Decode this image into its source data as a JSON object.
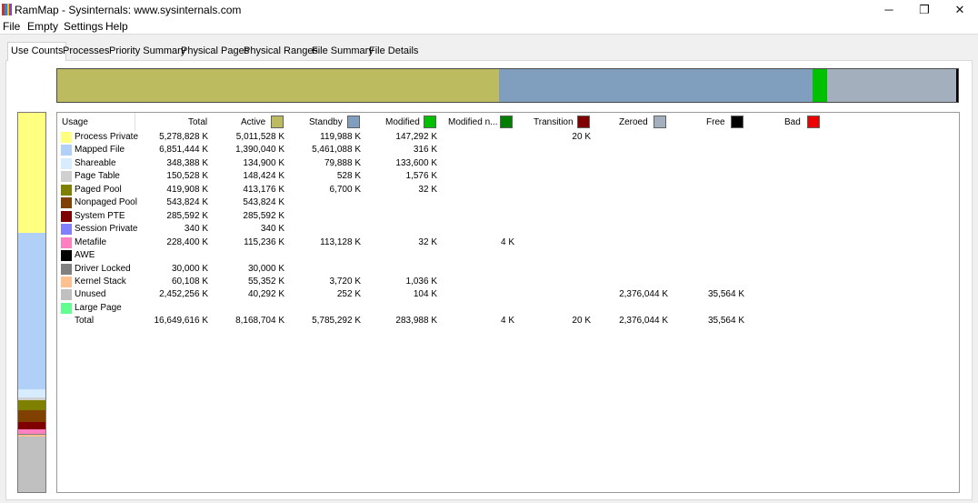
{
  "window": {
    "title": "RamMap - Sysinternals: www.sysinternals.com",
    "app_icon_colors": [
      "#c0392b",
      "#2e86de",
      "#f1c40f",
      "#8e44ad"
    ],
    "minimize_glyph": "─",
    "maximize_glyph": "❐",
    "close_glyph": "✕"
  },
  "menu": {
    "items": [
      "File",
      "Empty",
      "Settings",
      "Help"
    ]
  },
  "tabs": [
    "Use Counts",
    "Processes",
    "Priority Summary",
    "Physical Pages",
    "Physical Ranges",
    "File Summary",
    "File Details"
  ],
  "active_tab": "Use Counts",
  "columns": [
    {
      "label": "Usage",
      "color": null
    },
    {
      "label": "Total",
      "color": null
    },
    {
      "label": "Active",
      "color": "#bdbb5f"
    },
    {
      "label": "Standby",
      "color": "#809fbf"
    },
    {
      "label": "Modified",
      "color": "#00c000"
    },
    {
      "label": "Modified n...",
      "color": "#007f00"
    },
    {
      "label": "Transition",
      "color": "#800000"
    },
    {
      "label": "Zeroed",
      "color": "#a3afbd"
    },
    {
      "label": "Free",
      "color": "#000000"
    },
    {
      "label": "Bad",
      "color": "#ee0000"
    }
  ],
  "rows": [
    {
      "label": "Process Private",
      "color": "#ffff80",
      "total": "5,278,828 K",
      "active": "5,011,528 K",
      "standby": "119,988 K",
      "modified": "147,292 K",
      "modified_n": "",
      "transition": "20 K",
      "zeroed": "",
      "free": "",
      "bad": ""
    },
    {
      "label": "Mapped File",
      "color": "#b0d0f8",
      "total": "6,851,444 K",
      "active": "1,390,040 K",
      "standby": "5,461,088 K",
      "modified": "316 K",
      "modified_n": "",
      "transition": "",
      "zeroed": "",
      "free": "",
      "bad": ""
    },
    {
      "label": "Shareable",
      "color": "#d8ecff",
      "total": "348,388 K",
      "active": "134,900 K",
      "standby": "79,888 K",
      "modified": "133,600 K",
      "modified_n": "",
      "transition": "",
      "zeroed": "",
      "free": "",
      "bad": ""
    },
    {
      "label": "Page Table",
      "color": "#d0d0d0",
      "total": "150,528 K",
      "active": "148,424 K",
      "standby": "528 K",
      "modified": "1,576 K",
      "modified_n": "",
      "transition": "",
      "zeroed": "",
      "free": "",
      "bad": ""
    },
    {
      "label": "Paged Pool",
      "color": "#808000",
      "total": "419,908 K",
      "active": "413,176 K",
      "standby": "6,700 K",
      "modified": "32 K",
      "modified_n": "",
      "transition": "",
      "zeroed": "",
      "free": "",
      "bad": ""
    },
    {
      "label": "Nonpaged Pool",
      "color": "#804000",
      "total": "543,824 K",
      "active": "543,824 K",
      "standby": "",
      "modified": "",
      "modified_n": "",
      "transition": "",
      "zeroed": "",
      "free": "",
      "bad": ""
    },
    {
      "label": "System PTE",
      "color": "#800000",
      "total": "285,592 K",
      "active": "285,592 K",
      "standby": "",
      "modified": "",
      "modified_n": "",
      "transition": "",
      "zeroed": "",
      "free": "",
      "bad": ""
    },
    {
      "label": "Session Private",
      "color": "#8080ff",
      "total": "340 K",
      "active": "340 K",
      "standby": "",
      "modified": "",
      "modified_n": "",
      "transition": "",
      "zeroed": "",
      "free": "",
      "bad": ""
    },
    {
      "label": "Metafile",
      "color": "#ff80c0",
      "total": "228,400 K",
      "active": "115,236 K",
      "standby": "113,128 K",
      "modified": "32 K",
      "modified_n": "4 K",
      "transition": "",
      "zeroed": "",
      "free": "",
      "bad": ""
    },
    {
      "label": "AWE",
      "color": "#000000",
      "total": "",
      "active": "",
      "standby": "",
      "modified": "",
      "modified_n": "",
      "transition": "",
      "zeroed": "",
      "free": "",
      "bad": ""
    },
    {
      "label": "Driver Locked",
      "color": "#808080",
      "total": "30,000 K",
      "active": "30,000 K",
      "standby": "",
      "modified": "",
      "modified_n": "",
      "transition": "",
      "zeroed": "",
      "free": "",
      "bad": ""
    },
    {
      "label": "Kernel Stack",
      "color": "#ffc090",
      "total": "60,108 K",
      "active": "55,352 K",
      "standby": "3,720 K",
      "modified": "1,036 K",
      "modified_n": "",
      "transition": "",
      "zeroed": "",
      "free": "",
      "bad": ""
    },
    {
      "label": "Unused",
      "color": "#c0c0c0",
      "total": "2,452,256 K",
      "active": "40,292 K",
      "standby": "252 K",
      "modified": "104 K",
      "modified_n": "",
      "transition": "",
      "zeroed": "2,376,044 K",
      "free": "35,564 K",
      "bad": ""
    },
    {
      "label": "Large Page",
      "color": "#60ff90",
      "total": "",
      "active": "",
      "standby": "",
      "modified": "",
      "modified_n": "",
      "transition": "",
      "zeroed": "",
      "free": "",
      "bad": ""
    },
    {
      "label": "Total",
      "color": null,
      "total": "16,649,616 K",
      "active": "8,168,704 K",
      "standby": "5,785,292 K",
      "modified": "283,988 K",
      "modified_n": "4 K",
      "transition": "20 K",
      "zeroed": "2,376,044 K",
      "free": "35,564 K",
      "bad": ""
    }
  ],
  "top_bar_segments": [
    {
      "name": "active",
      "color": "#bdbb5f",
      "value": 8168704
    },
    {
      "name": "standby",
      "color": "#809fbf",
      "value": 5785292
    },
    {
      "name": "modified",
      "color": "#00c000",
      "value": 283988
    },
    {
      "name": "zeroed",
      "color": "#a3afbd",
      "value": 2376044
    },
    {
      "name": "free",
      "color": "#000000",
      "value": 35564
    }
  ],
  "left_bar_segments": [
    {
      "name": "process-private",
      "color": "#ffff80",
      "value": 5278828
    },
    {
      "name": "mapped-file",
      "color": "#b0d0f8",
      "value": 6851444
    },
    {
      "name": "shareable",
      "color": "#d8ecff",
      "value": 348388
    },
    {
      "name": "page-table",
      "color": "#d0d0d0",
      "value": 150528
    },
    {
      "name": "paged-pool",
      "color": "#808000",
      "value": 419908
    },
    {
      "name": "nonpaged-pool",
      "color": "#804000",
      "value": 543824
    },
    {
      "name": "system-pte",
      "color": "#800000",
      "value": 285592
    },
    {
      "name": "metafile",
      "color": "#ff80c0",
      "value": 228400
    },
    {
      "name": "driver-locked",
      "color": "#808080",
      "value": 30000
    },
    {
      "name": "kernel-stack",
      "color": "#ffc090",
      "value": 60108
    },
    {
      "name": "unused",
      "color": "#c0c0c0",
      "value": 2452256
    }
  ]
}
